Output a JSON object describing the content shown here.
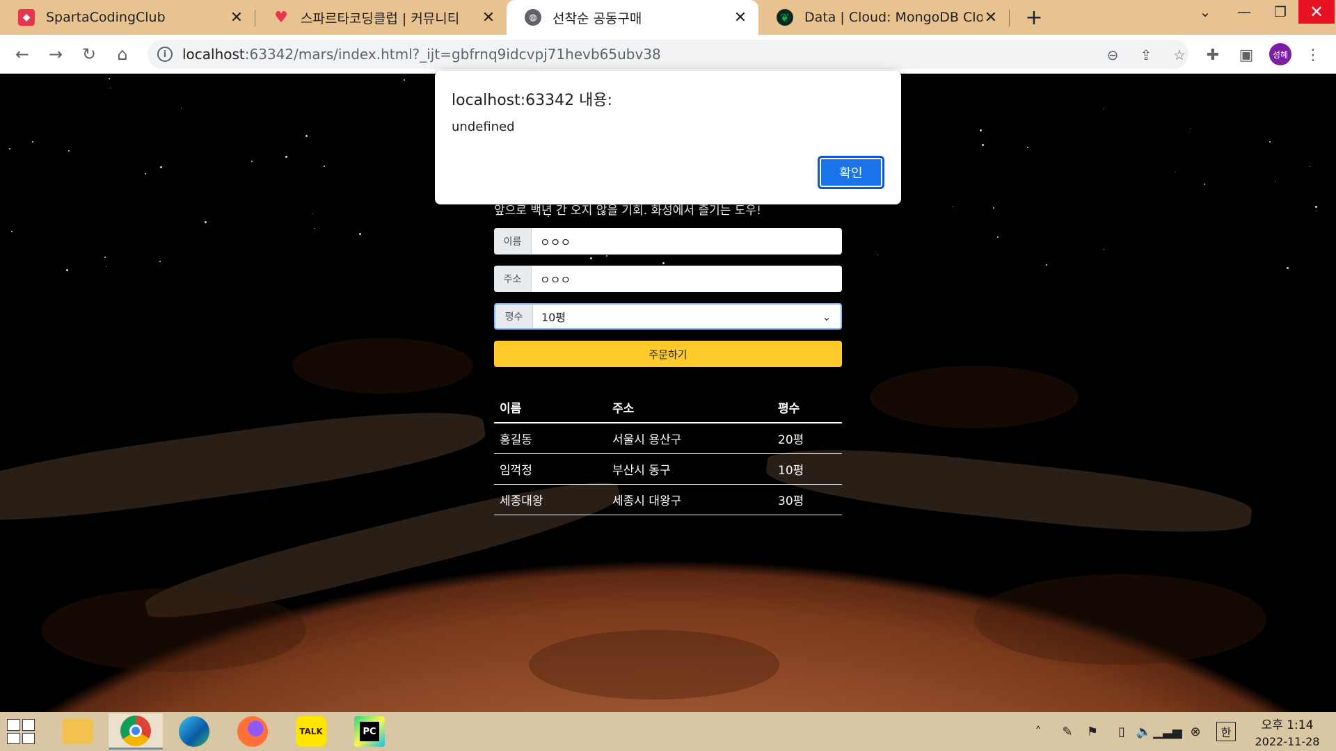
{
  "browser": {
    "tabs": [
      {
        "title": "SpartaCodingClub",
        "favicon": "sparta-icon",
        "active": false
      },
      {
        "title": "스파르타코딩클럽 | 커뮤니티",
        "favicon": "heart-icon",
        "active": false
      },
      {
        "title": "선착순 공동구매",
        "favicon": "globe-icon",
        "active": true
      },
      {
        "title": "Data | Cloud: MongoDB Cloud",
        "favicon": "mongodb-leaf-icon",
        "active": false
      }
    ],
    "url_host": "localhost",
    "url_rest": ":63342/mars/index.html?_ijt=gbfrnq9idcvpj71hevb65ubv38",
    "profile_label": "성혜"
  },
  "page": {
    "subtitle": "앞으로 백년 간 오지 않을 기회. 화성에서 즐기는 도우!",
    "form": {
      "name_label": "이름",
      "name_value": "ㅇㅇㅇ",
      "address_label": "주소",
      "address_value": "ㅇㅇㅇ",
      "size_label": "평수",
      "size_value": "10평"
    },
    "order_button": "주문하기",
    "table": {
      "headers": [
        "이름",
        "주소",
        "평수"
      ],
      "rows": [
        [
          "홍길동",
          "서울시 용산구",
          "20평"
        ],
        [
          "임꺽정",
          "부산시 동구",
          "10평"
        ],
        [
          "세종대왕",
          "세종시 대왕구",
          "30평"
        ]
      ]
    }
  },
  "dialog": {
    "title": "localhost:63342 내용:",
    "message": "undefined",
    "ok_label": "확인"
  },
  "taskbar": {
    "apps": [
      "file-explorer-icon",
      "chrome-icon",
      "edge-icon",
      "firefox-icon",
      "kakaotalk-icon",
      "pycharm-icon"
    ],
    "kakao_label": "TALK",
    "pycharm_label": "PC",
    "ime_label": "한",
    "time": "오후 1:14",
    "date": "2022-11-28"
  },
  "colors": {
    "titlebar": "#e8c38f",
    "order_button": "#ffca2c",
    "dialog_button": "#1a73e8",
    "profile": "#7b1fa2"
  }
}
